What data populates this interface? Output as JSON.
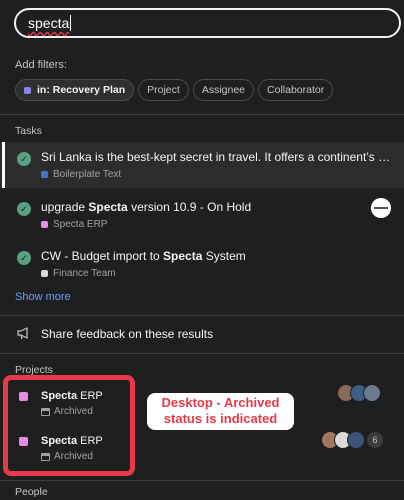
{
  "search": {
    "query": "specta"
  },
  "filters": {
    "label": "Add filters:",
    "chips": [
      {
        "label": "in: Recovery Plan",
        "active": true
      },
      {
        "label": "Project",
        "active": false
      },
      {
        "label": "Assignee",
        "active": false
      },
      {
        "label": "Collaborator",
        "active": false
      }
    ]
  },
  "tasks": {
    "section_title": "Tasks",
    "items": [
      {
        "title_pre": "Sri Lanka is the best-kept secret in travel. It offers a continent’s w...",
        "title_bold": "",
        "title_post": "",
        "subtitle": "Boilerplate Text",
        "subtitle_color": "#4573d2"
      },
      {
        "title_pre": "upgrade ",
        "title_bold": "Specta",
        "title_post": " version 10.9 - On Hold",
        "subtitle": "Specta ERP",
        "subtitle_color": "#e98ce3"
      },
      {
        "title_pre": "CW - Budget import to ",
        "title_bold": "Specta",
        "title_post": " System",
        "subtitle": "Finance Team",
        "subtitle_color": "#d9d9d9"
      }
    ],
    "show_more": "Show more"
  },
  "feedback": {
    "label": "Share feedback on these results",
    "icon": "megaphone-icon"
  },
  "projects": {
    "section_title": "Projects",
    "items": [
      {
        "name_bold": "Specta",
        "name_rest": " ERP",
        "status": "Archived",
        "extra_count": ""
      },
      {
        "name_bold": "Specta",
        "name_rest": " ERP",
        "status": "Archived",
        "extra_count": "6"
      }
    ]
  },
  "people": {
    "section_title": "People"
  },
  "annotation": {
    "line1": "Desktop - Archived",
    "line2": "status is indicated"
  },
  "colors": {
    "background": "#1e1f21",
    "accent_red": "#e63a4a",
    "link_blue": "#6a9dfd",
    "complete_green": "#58a182",
    "project_pink": "#e98ce3"
  }
}
